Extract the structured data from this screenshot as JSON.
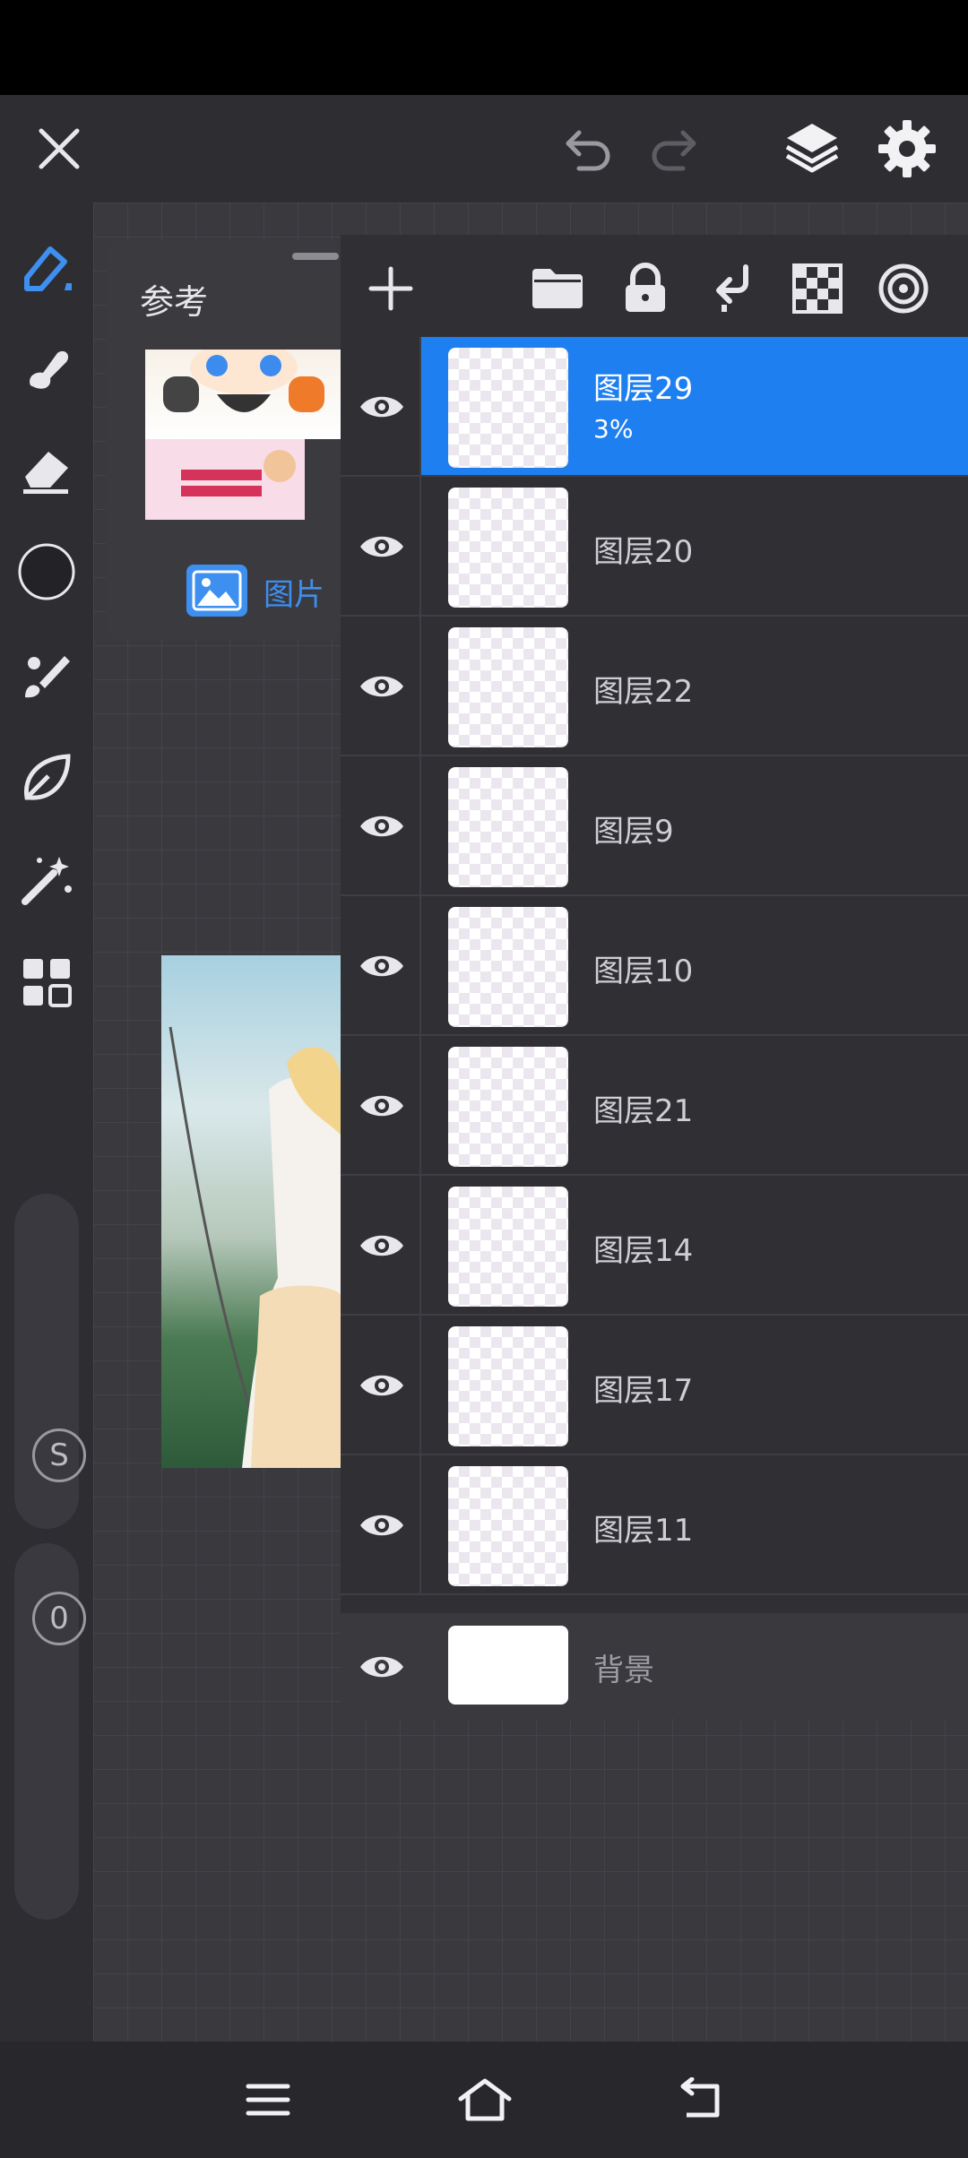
{
  "topbar": {
    "close_icon": "close-icon",
    "undo_icon": "undo-icon",
    "redo_icon": "redo-icon",
    "layers_icon": "layers-icon",
    "settings_icon": "gear-icon"
  },
  "tools": [
    "pen-icon",
    "smudge-icon",
    "eraser-icon",
    "color-circle-icon",
    "brush-icon",
    "leaf-icon",
    "magic-wand-icon",
    "grid-icon"
  ],
  "sliders": {
    "size_label": "S",
    "opacity_label": "0"
  },
  "reference": {
    "title": "参考",
    "image_button_label": "图片"
  },
  "layer_toolbar": [
    "add-icon",
    "folder-icon",
    "lock-icon",
    "merge-down-icon",
    "checker-icon",
    "target-icon"
  ],
  "layers": [
    {
      "name": "图层29",
      "opacity": "3%",
      "selected": true
    },
    {
      "name": "图层20"
    },
    {
      "name": "图层22"
    },
    {
      "name": "图层9"
    },
    {
      "name": "图层10"
    },
    {
      "name": "图层21"
    },
    {
      "name": "图层14"
    },
    {
      "name": "图层17"
    },
    {
      "name": "图层11"
    }
  ],
  "background_layer": {
    "name": "背景"
  },
  "navbar": [
    "menu-icon",
    "home-icon",
    "back-icon"
  ]
}
